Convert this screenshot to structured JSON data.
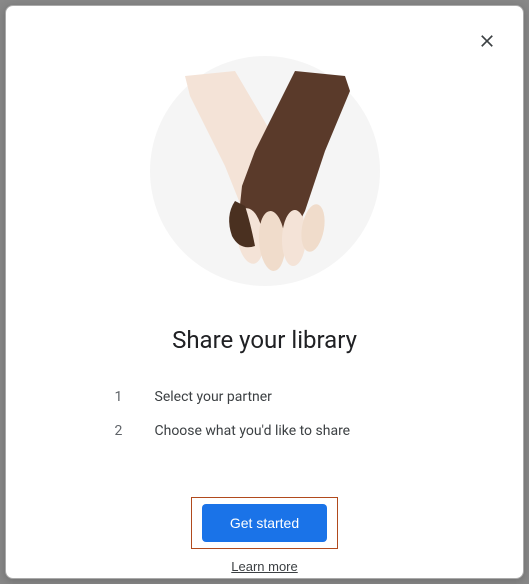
{
  "title": "Share your library",
  "steps": [
    {
      "num": "1",
      "text": "Select your partner"
    },
    {
      "num": "2",
      "text": "Choose what you'd like to share"
    }
  ],
  "buttons": {
    "primary": "Get started",
    "learn_more": "Learn more"
  }
}
